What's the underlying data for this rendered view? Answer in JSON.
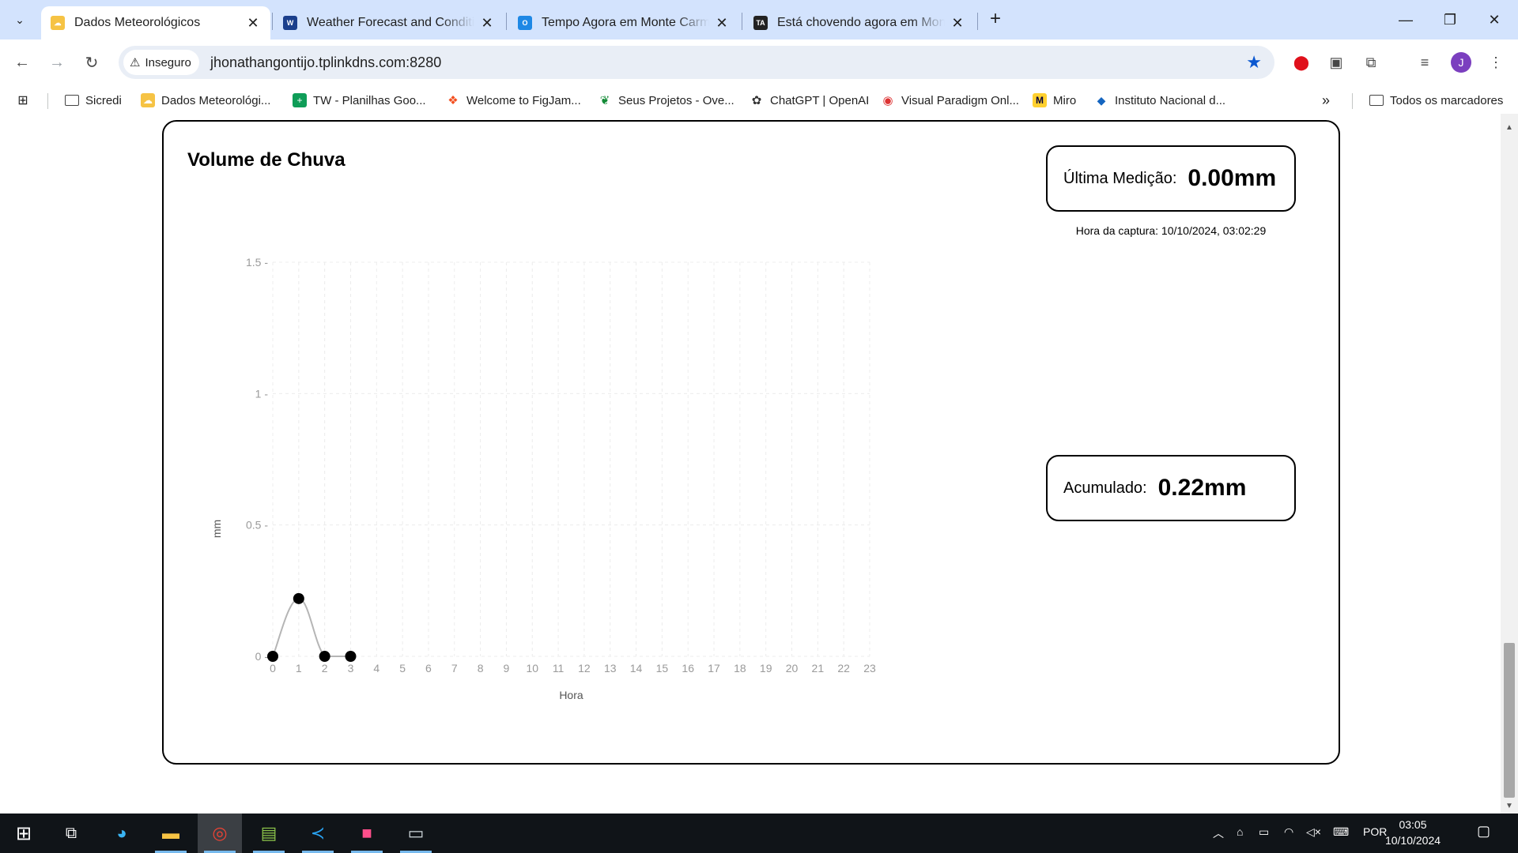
{
  "browser": {
    "tabs": [
      {
        "title": "Dados Meteorológicos",
        "favicon": "weather-cloud-sun",
        "active": true
      },
      {
        "title": "Weather Forecast and Conditions",
        "favicon": "weather-channel",
        "active": false
      },
      {
        "title": "Tempo Agora em Monte Carmelo",
        "favicon": "outlook-blue",
        "active": false
      },
      {
        "title": "Está chovendo agora em Monte Carmelo",
        "favicon": "ta-logo",
        "active": false
      }
    ],
    "security_label": "Inseguro",
    "url": "jhonathangontijo.tplinkdns.com:8280",
    "avatar_letter": "J",
    "bookmarks": [
      {
        "label": "Sicredi",
        "icon": "folder-icon"
      },
      {
        "label": "Dados Meteorológi...",
        "icon": "weather-icon"
      },
      {
        "label": "TW - Planilhas Goo...",
        "icon": "sheets-icon"
      },
      {
        "label": "Welcome to FigJam...",
        "icon": "figma-icon"
      },
      {
        "label": "Seus Projetos - Ove...",
        "icon": "overleaf-icon"
      },
      {
        "label": "ChatGPT | OpenAI",
        "icon": "openai-icon"
      },
      {
        "label": "Visual Paradigm Onl...",
        "icon": "vp-icon"
      },
      {
        "label": "Miro",
        "icon": "miro-icon"
      },
      {
        "label": "Instituto Nacional d...",
        "icon": "inmet-icon"
      }
    ],
    "all_bookmarks_label": "Todos os marcadores"
  },
  "page": {
    "card_title": "Volume de Chuva",
    "last_measurement": {
      "label": "Última Medição:",
      "value": "0.00mm"
    },
    "capture_time": "Hora da captura: 10/10/2024, 03:02:29",
    "accumulated": {
      "label": "Acumulado:",
      "value": "0.22mm"
    }
  },
  "chart_data": {
    "type": "line",
    "title": "",
    "xlabel": "Hora",
    "ylabel": "mm",
    "x_ticks": [
      "0",
      "1",
      "2",
      "3",
      "4",
      "5",
      "6",
      "7",
      "8",
      "9",
      "10",
      "11",
      "12",
      "13",
      "14",
      "15",
      "16",
      "17",
      "18",
      "19",
      "20",
      "21",
      "22",
      "23"
    ],
    "y_ticks": [
      "0",
      "0.5",
      "1",
      "1.5"
    ],
    "xlim": [
      0,
      23
    ],
    "ylim": [
      0,
      1.5
    ],
    "grid": true,
    "series": [
      {
        "x": [
          0,
          1,
          2,
          3
        ],
        "y": [
          0,
          0.22,
          0,
          0
        ],
        "color": "#b5b5b5",
        "marker_color": "#000000"
      }
    ]
  },
  "taskbar": {
    "language": "POR",
    "time": "03:05",
    "date": "10/10/2024"
  }
}
